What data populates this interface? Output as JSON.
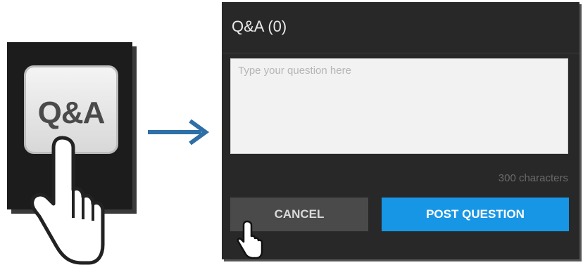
{
  "qa_tile": {
    "label": "Q&A"
  },
  "panel": {
    "title": "Q&A (0)",
    "question_placeholder": "Type your question here",
    "question_value": "",
    "char_count": "300 characters",
    "cancel_label": "CANCEL",
    "post_label": "POST QUESTION"
  },
  "colors": {
    "panel_bg": "#282828",
    "post_button": "#1796e6",
    "cancel_button": "#4a4a4a",
    "arrow": "#2f6fa8"
  },
  "icons": {
    "tile_hand": "pointing-hand-icon",
    "arrow": "arrow-right-icon",
    "button_hand": "pointing-hand-icon"
  }
}
